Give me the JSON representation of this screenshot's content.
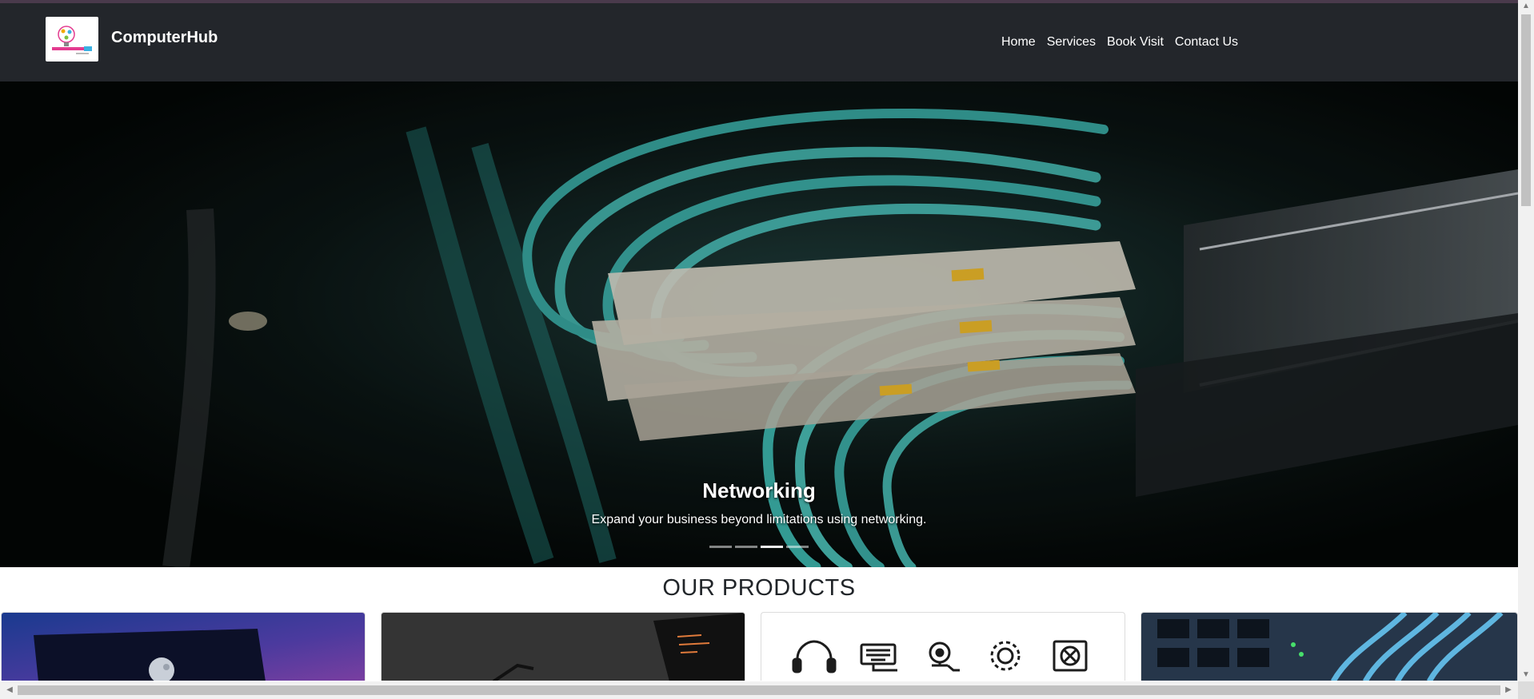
{
  "brand": {
    "name": "ComputerHub",
    "logo_alt": "ComputerHub"
  },
  "nav": {
    "items": [
      {
        "label": "Home"
      },
      {
        "label": "Services"
      },
      {
        "label": "Book Visit"
      },
      {
        "label": "Contact Us"
      }
    ]
  },
  "hero": {
    "title": "Networking",
    "text": "Expand your business beyond limitations using networking.",
    "slide_count": 4,
    "active_slide": 3
  },
  "products": {
    "title": "OUR PRODUCTS",
    "cards": [
      {
        "subject": "laptop with moon wallpaper"
      },
      {
        "subject": "dark laptop with code"
      },
      {
        "subject": "accessory icons",
        "icons": [
          "headphones-icon",
          "keyboard-icon",
          "webcam-icon",
          "gear-icon",
          "speaker-icon"
        ]
      },
      {
        "subject": "network switch with cables"
      }
    ]
  },
  "colors": {
    "navbar": "#23262b",
    "accent_line": "#4a3a4c",
    "teal_cable": "#3aa6a0",
    "connector_yellow": "#e6b42a"
  }
}
